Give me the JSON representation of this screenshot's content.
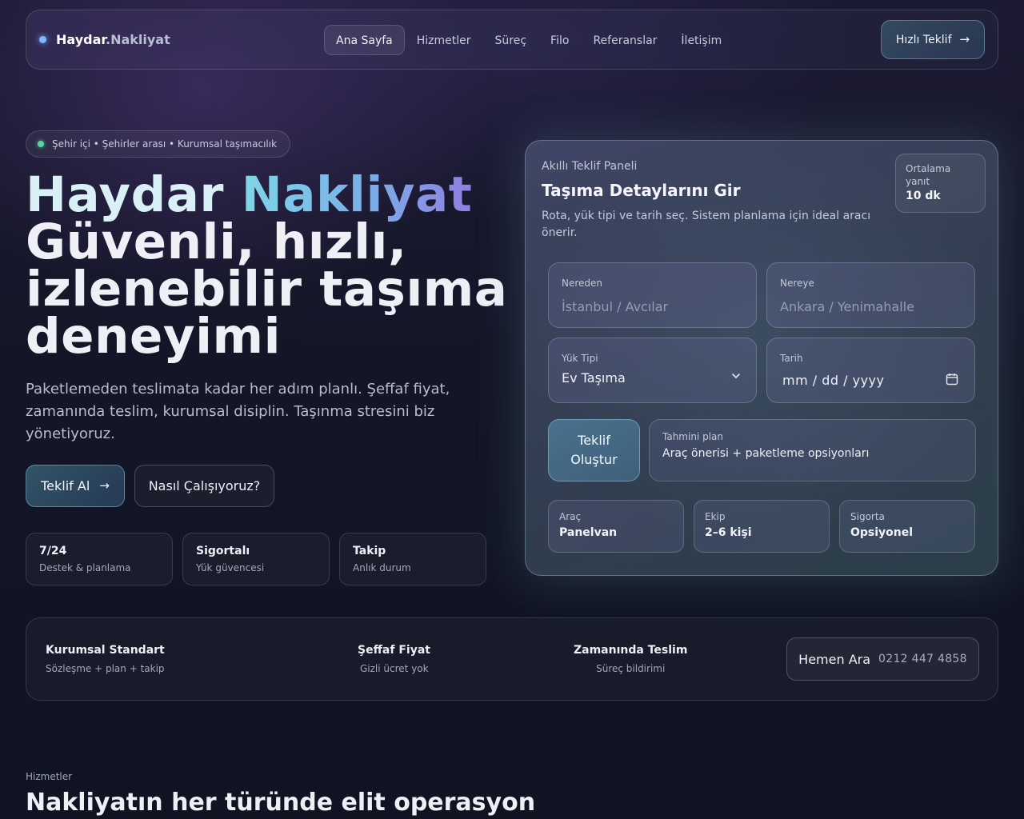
{
  "nav": {
    "brand_primary": "Haydar",
    "brand_secondary": ".Nakliyat",
    "links": [
      "Ana Sayfa",
      "Hizmetler",
      "Süreç",
      "Filo",
      "Referanslar",
      "İletişim"
    ],
    "cta_label": "Hızlı Teklif"
  },
  "hero": {
    "pill_text": "Şehir içi • Şehirler arası • Kurumsal taşımacılık",
    "title_word1": "Haydar",
    "title_word2": "Nakliyat",
    "title_line2": "Güvenli, hızlı,",
    "title_line3": "izlenebilir taşıma",
    "title_line4": "deneyimi",
    "description": "Paketlemeden teslimata kadar her adım planlı. Şeffaf fiyat, zamanında teslim, kurumsal disiplin. Taşınma stresini biz yönetiyoruz.",
    "primary_button": "Teklif Al",
    "secondary_button": "Nasıl Çalışıyoruz?",
    "stats": [
      {
        "title": "7/24",
        "sub": "Destek & planlama"
      },
      {
        "title": "Sigortalı",
        "sub": "Yük güvencesi"
      },
      {
        "title": "Takip",
        "sub": "Anlık durum"
      }
    ]
  },
  "panel": {
    "kicker": "Akıllı Teklif Paneli",
    "title": "Taşıma Detaylarını Gir",
    "description": "Rota, yük tipi ve tarih seç. Sistem planlama için ideal aracı önerir.",
    "badge_label": "Ortalama yanıt",
    "badge_value": "10 dk",
    "from_label": "Nereden",
    "from_placeholder": "İstanbul / Avcılar",
    "to_label": "Nereye",
    "to_placeholder": "Ankara / Yenimahalle",
    "load_label": "Yük Tipi",
    "load_value": "Ev Taşıma",
    "date_label": "Tarih",
    "date_value": "mm / dd / yyyy",
    "generate_button": "Teklif Oluştur",
    "plan_label": "Tahmini plan",
    "plan_value": "Araç önerisi + paketleme opsiyonları",
    "minis": [
      {
        "label": "Araç",
        "value": "Panelvan"
      },
      {
        "label": "Ekip",
        "value": "2–6 kişi"
      },
      {
        "label": "Sigorta",
        "value": "Opsiyonel"
      }
    ]
  },
  "features": [
    {
      "title": "Kurumsal Standart",
      "sub": "Sözleşme + plan + takip"
    },
    {
      "title": "Şeffaf Fiyat",
      "sub": "Gizli ücret yok"
    },
    {
      "title": "Zamanında Teslim",
      "sub": "Süreç bildirimi"
    }
  ],
  "call": {
    "label": "Hemen Ara",
    "phone": "0212 447 4858"
  },
  "services": {
    "kicker": "Hizmetler",
    "title": "Nakliyatın her türünde elit operasyon"
  }
}
